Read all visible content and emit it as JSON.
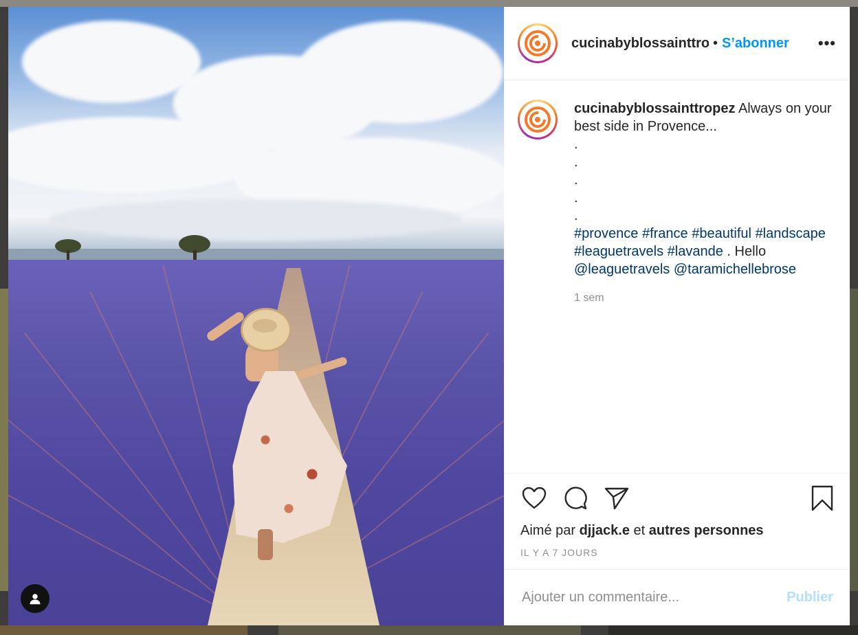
{
  "post": {
    "username": "cucinabyblossainttropez",
    "follow_label": "S’abonner",
    "separator": "•",
    "more_label": "•••",
    "caption": "Always on your best side in Provence...",
    "caption_dots": [
      ".",
      ".",
      ".",
      ".",
      "."
    ],
    "hashtags": [
      "#provence",
      "#france",
      "#beautiful",
      "#landscape",
      "#leaguetravels",
      "#lavande"
    ],
    "trailing": ".",
    "hello": "Hello",
    "mentions": [
      "@leaguetravels",
      "@taramichellebrose"
    ],
    "caption_time": "1 sem",
    "liked_by_prefix": "Aimé par",
    "liked_by_user": "djjack.e",
    "liked_by_join": "et",
    "liked_by_others": "autres personnes",
    "posted_date": "IL Y A 7 JOURS"
  },
  "comment_form": {
    "placeholder": "Ajouter un commentaire...",
    "publish_label": "Publier"
  },
  "icons": {
    "like": "heart-icon",
    "comment": "comment-icon",
    "share": "paper-plane-icon",
    "save": "bookmark-icon",
    "user_tag": "user-icon"
  },
  "colors": {
    "accent": "#0095f6",
    "hashtag": "#00376b",
    "publish_disabled": "#b2dffc"
  }
}
